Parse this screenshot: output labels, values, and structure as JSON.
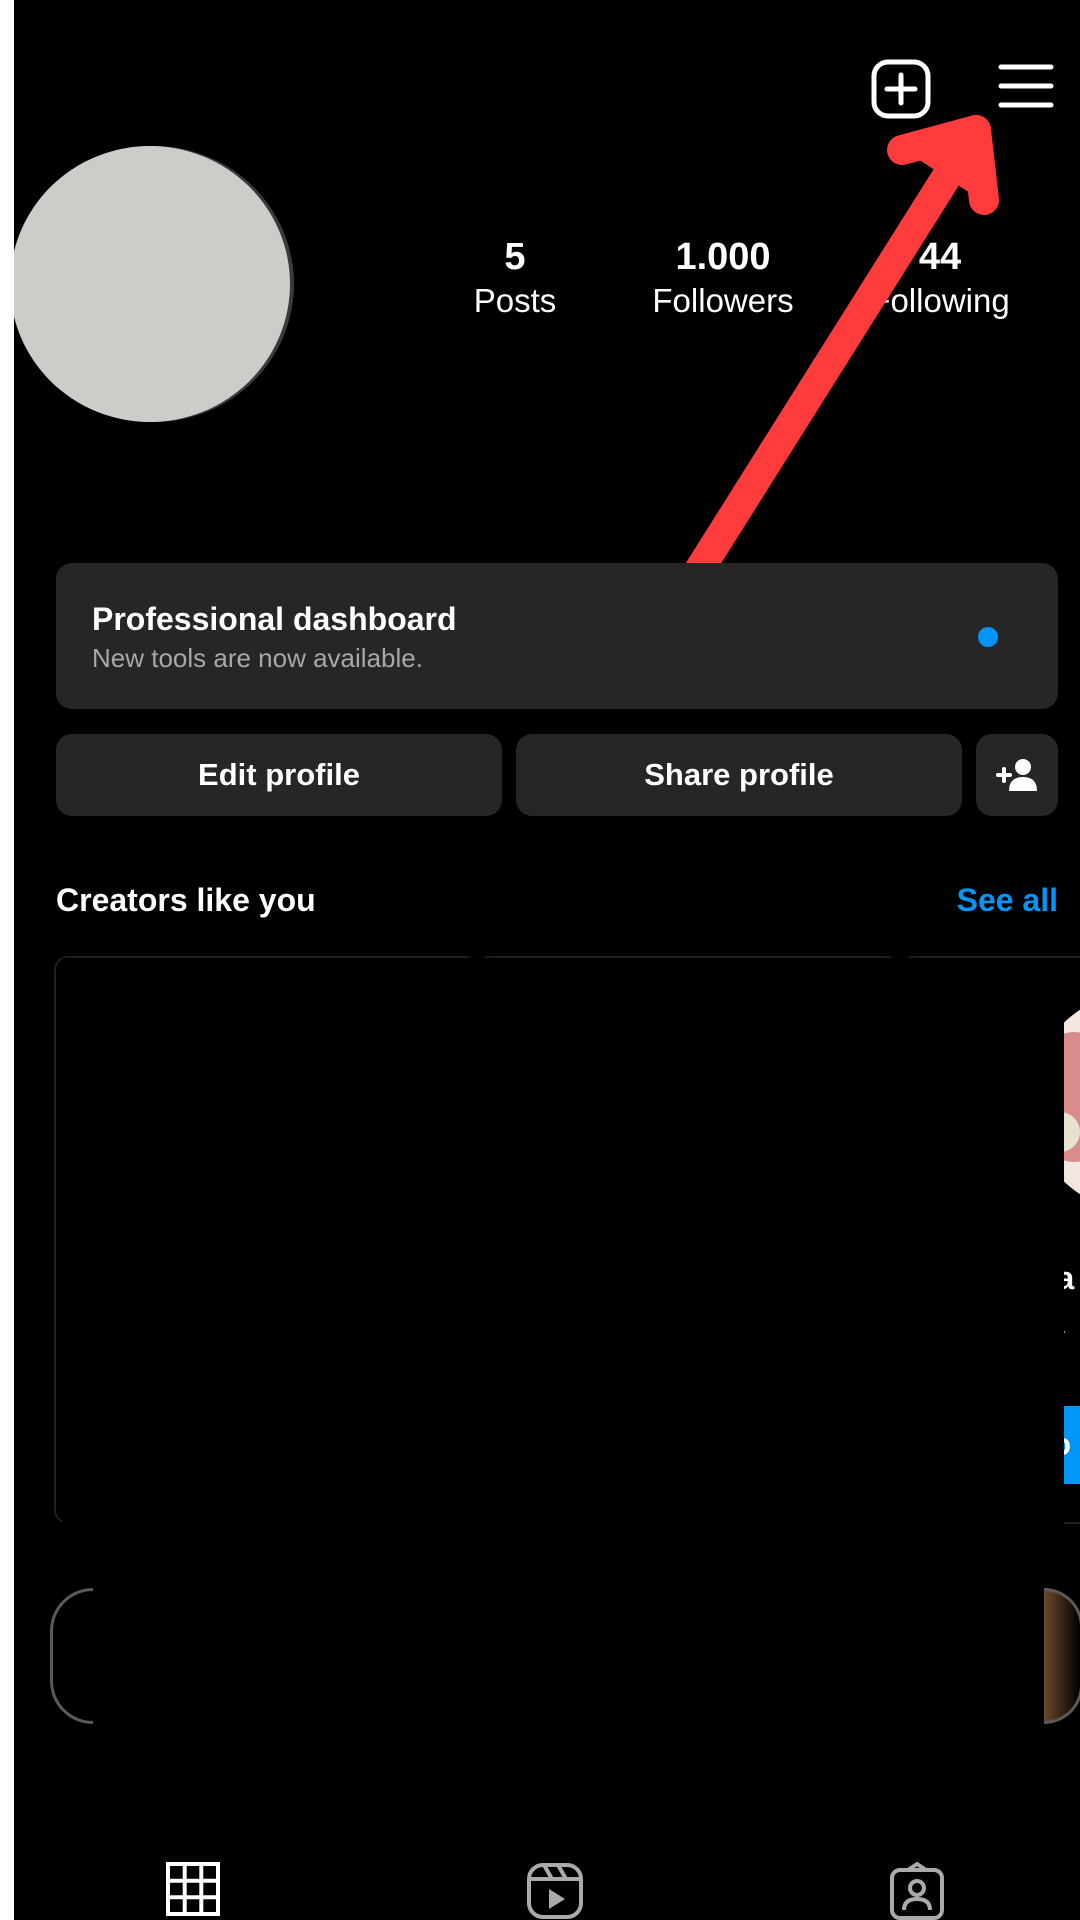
{
  "header": {
    "new_post_icon": "plus-square-icon",
    "menu_icon": "hamburger-menu-icon"
  },
  "profile": {
    "stats": [
      {
        "value": "5",
        "label": "Posts"
      },
      {
        "value": "1.000",
        "label": "Followers"
      },
      {
        "value": "44",
        "label": "Following"
      }
    ]
  },
  "dashboard": {
    "title": "Professional dashboard",
    "subtitle": "New tools are now available."
  },
  "actions": {
    "edit_label": "Edit profile",
    "share_label": "Share profile",
    "discover_icon": "add-person-icon"
  },
  "creators": {
    "title": "Creators like you",
    "see_all": "See all",
    "partial_name": "bia",
    "partial_handle": "bia",
    "partial_follow": "Fo"
  },
  "tabs": [
    {
      "icon": "grid-icon"
    },
    {
      "icon": "reels-icon"
    },
    {
      "icon": "tagged-icon"
    }
  ],
  "colors": {
    "background": "#000000",
    "card": "#262626",
    "accent": "#0095f6",
    "arrow": "#ff3b3b"
  }
}
